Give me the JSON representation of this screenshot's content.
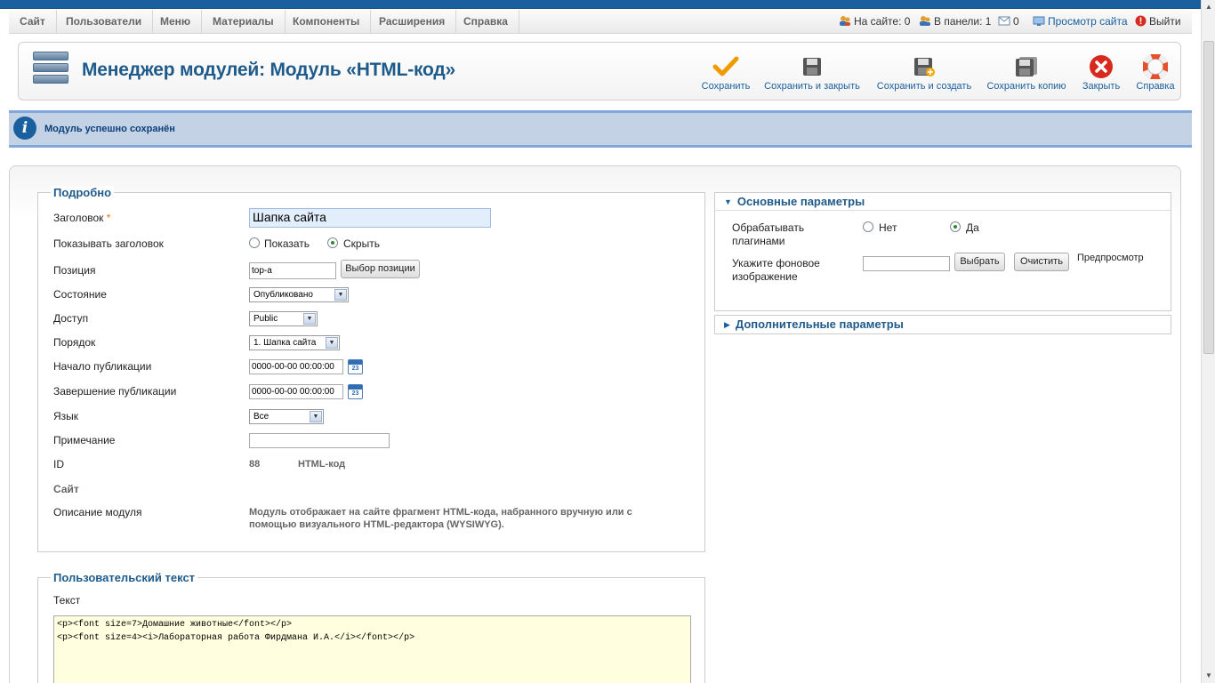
{
  "menu": {
    "items": [
      "Сайт",
      "Пользователи",
      "Меню",
      "Материалы",
      "Компоненты",
      "Расширения",
      "Справка"
    ]
  },
  "status": {
    "on_site": "На сайте: 0",
    "in_panel": "В панели: 1",
    "messages": "0",
    "view_site": "Просмотр сайта",
    "logout": "Выйти"
  },
  "header": {
    "title": "Менеджер модулей: Модуль «HTML-код»"
  },
  "toolbar": {
    "save": "Сохранить",
    "save_close": "Сохранить и закрыть",
    "save_new": "Сохранить и создать",
    "save_copy": "Сохранить копию",
    "close": "Закрыть",
    "help": "Справка"
  },
  "message": {
    "text": "Модуль успешно сохранён"
  },
  "details": {
    "legend": "Подробно",
    "title_label": "Заголовок",
    "title_required": "*",
    "title_value": "Шапка сайта",
    "show_title_label": "Показывать заголовок",
    "show_option": "Показать",
    "hide_option": "Скрыть",
    "position_label": "Позиция",
    "position_value": "top-a",
    "position_button": "Выбор позиции",
    "state_label": "Состояние",
    "state_value": "Опубликовано",
    "access_label": "Доступ",
    "access_value": "Public",
    "order_label": "Порядок",
    "order_value": "1. Шапка сайта",
    "publish_up_label": "Начало публикации",
    "publish_up_value": "0000-00-00 00:00:00",
    "publish_down_label": "Завершение публикации",
    "publish_down_value": "0000-00-00 00:00:00",
    "calendar_day": "23",
    "language_label": "Язык",
    "language_value": "Все",
    "note_label": "Примечание",
    "note_value": "",
    "id_label": "ID",
    "id_value": "88",
    "module_type": "HTML-код",
    "site_label": "Сайт",
    "description_label": "Описание модуля",
    "description_line1": "Модуль отображает на сайте фрагмент HTML-кода, набранного вручную или с",
    "description_line2": "помощью визуального HTML-редактора (WYSIWYG)."
  },
  "custom": {
    "legend": "Пользовательский текст",
    "text_label": "Текст",
    "line1": "<p><font size=7>Домашние животные</font></p>",
    "line2": "<p><font size=4><i>Лабораторная работа Фирдмана И.А.</i></font></p>"
  },
  "basic_options": {
    "title": "Основные параметры",
    "prepare_label_1": "Обрабатывать",
    "prepare_label_2": "плагинами",
    "no_option": "Нет",
    "yes_option": "Да",
    "bg_label_1": "Укажите фоновое",
    "bg_label_2": "изображение",
    "bg_value": "",
    "select_button": "Выбрать",
    "clear_button": "Очистить",
    "preview": "Предпросмотр"
  },
  "advanced_options": {
    "title": "Дополнительные параметры"
  }
}
